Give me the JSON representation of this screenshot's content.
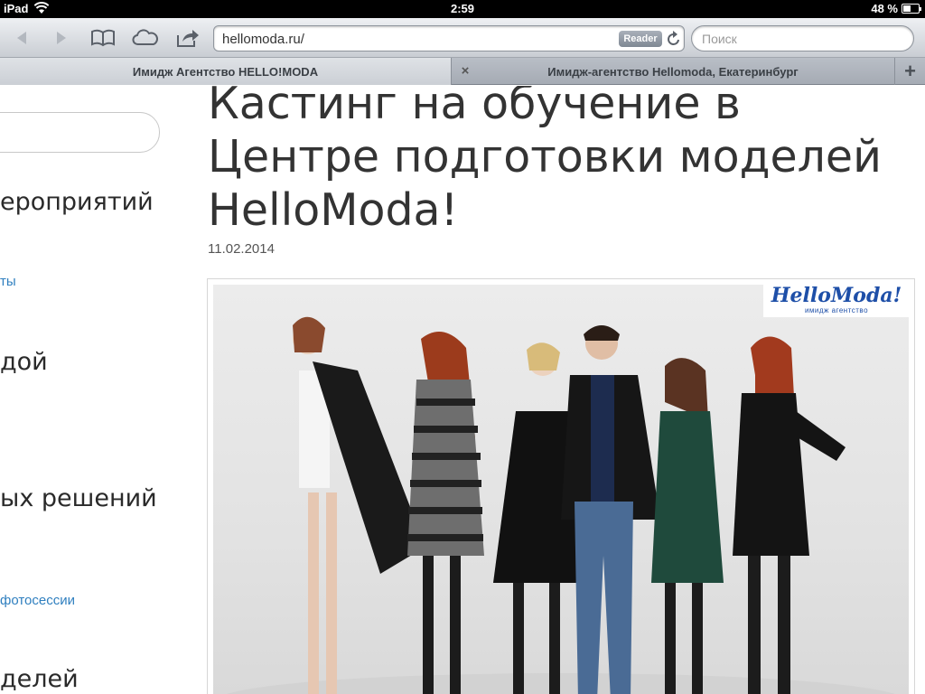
{
  "status_bar": {
    "carrier": "iPad",
    "time": "2:59",
    "battery": "48 %",
    "battery_level": 0.48
  },
  "toolbar": {
    "back_icon": "back-arrow-icon",
    "forward_icon": "forward-arrow-icon",
    "bookmarks_icon": "bookmarks-book-icon",
    "icloud_icon": "icloud-icon",
    "share_icon": "share-icon",
    "url": "hellomoda.ru/",
    "reader_label": "Reader",
    "reload_icon": "reload-icon",
    "search_placeholder": "Поиск"
  },
  "tabs": [
    {
      "title": "Имидж Агентство HELLO!MODA",
      "active": true
    },
    {
      "title": "Имидж-агентство Hellomoda, Екатеринбург",
      "active": false
    }
  ],
  "tab_bar": {
    "close_symbol": "×",
    "add_symbol": "+"
  },
  "sidebar": {
    "items": [
      {
        "kind": "heading",
        "text": "ероприятий"
      },
      {
        "kind": "link",
        "text": "ты"
      },
      {
        "kind": "heading",
        "text": "дой"
      },
      {
        "kind": "heading",
        "text": "ых решений"
      },
      {
        "kind": "link",
        "text": "фотосессии"
      },
      {
        "kind": "heading",
        "text": "делей"
      }
    ]
  },
  "article": {
    "title": "Кастинг на обучение в Центре подготовки моделей HelloModa!",
    "date": "11.02.2014",
    "image_logo": "HelloModa!",
    "image_logo_sub": "имидж агентство"
  }
}
